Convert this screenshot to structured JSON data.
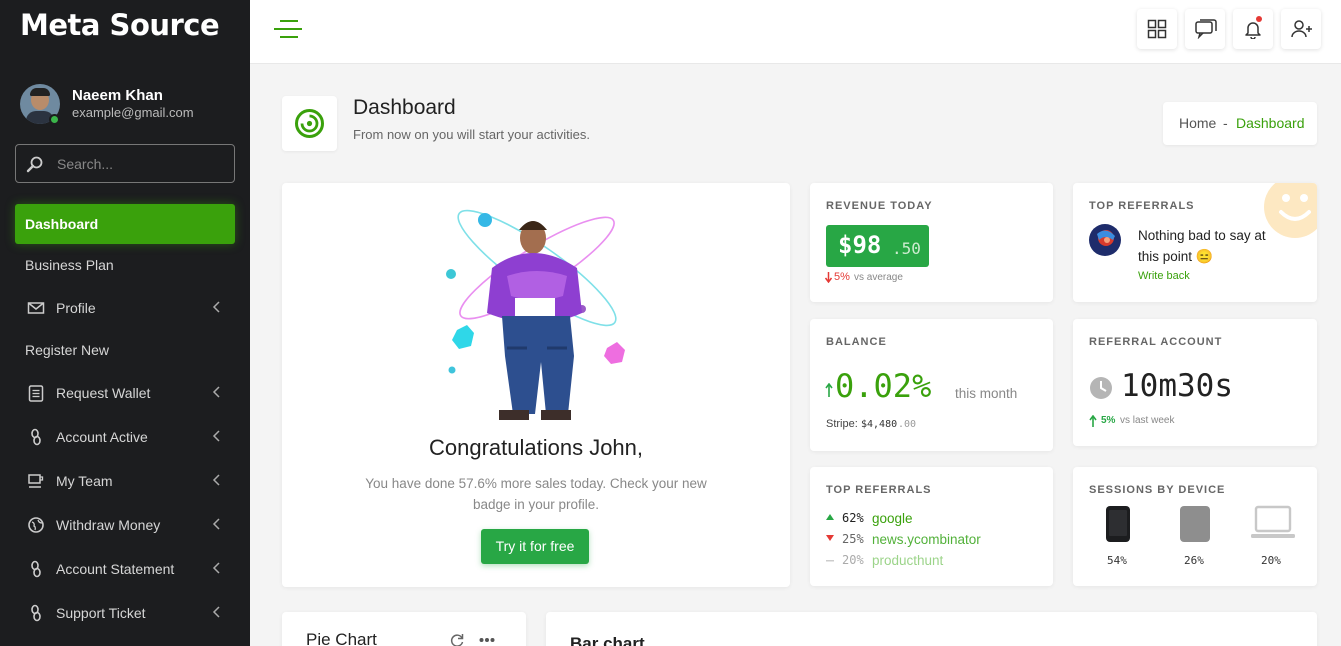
{
  "brand": "Meta Source",
  "user": {
    "name": "Naeem Khan",
    "email": "example@gmail.com"
  },
  "search": {
    "placeholder": "Search..."
  },
  "nav": [
    {
      "label": "Dashboard",
      "icon": "none",
      "active": true,
      "chevron": false
    },
    {
      "label": "Business Plan",
      "icon": "none",
      "chevron": false
    },
    {
      "label": "Profile",
      "icon": "envelope-icon",
      "chevron": true
    },
    {
      "label": "Register New",
      "icon": "none",
      "chevron": false
    },
    {
      "label": "Request Wallet",
      "icon": "clipboard-icon",
      "chevron": true
    },
    {
      "label": "Account Active",
      "icon": "link-icon",
      "chevron": true
    },
    {
      "label": "My Team",
      "icon": "cup-icon",
      "chevron": true
    },
    {
      "label": "Withdraw Money",
      "icon": "globe-icon",
      "chevron": true
    },
    {
      "label": "Account Statement",
      "icon": "link-icon",
      "chevron": true
    },
    {
      "label": "Support Ticket",
      "icon": "link-icon",
      "chevron": true
    }
  ],
  "topbar": {
    "icons": [
      "grid-icon",
      "chat-icon",
      "bell-icon",
      "add-user-icon"
    ]
  },
  "page": {
    "title": "Dashboard",
    "subtitle": "From now on you will start your activities.",
    "breadcrumb": {
      "home": "Home",
      "sep": "-",
      "current": "Dashboard"
    }
  },
  "congrats": {
    "title": "Congratulations John,",
    "text": "You have done 57.6% more sales today. Check your new badge in your profile.",
    "button": "Try it for free"
  },
  "revenue": {
    "label": "REVENUE TODAY",
    "amount": "$98",
    "cents": ".50",
    "change": "5%",
    "change_text": "vs average"
  },
  "top_referrals_1": {
    "label": "TOP REFERRALS",
    "message": "Nothing bad to say at this point",
    "emoji": "😑",
    "link": "Write back"
  },
  "balance": {
    "label": "BALANCE",
    "value": "0.02%",
    "period": "this month",
    "stripe_label": "Stripe:",
    "stripe_amount": "$4,480",
    "stripe_cents": ".00"
  },
  "referral_account": {
    "label": "REFERRAL ACCOUNT",
    "value": "10m30s",
    "change": "5%",
    "change_text": "vs last week"
  },
  "top_referrals_2": {
    "label": "TOP REFERRALS",
    "items": [
      {
        "pct": "62%",
        "name": "google",
        "trend": "up"
      },
      {
        "pct": "25%",
        "name": "news.ycombinator",
        "trend": "down"
      },
      {
        "pct": "20%",
        "name": "producthunt",
        "trend": "flat"
      }
    ]
  },
  "sessions": {
    "label": "SESSIONS BY DEVICE",
    "devices": [
      {
        "icon": "phone-icon",
        "pct": "54%"
      },
      {
        "icon": "tablet-icon",
        "pct": "26%"
      },
      {
        "icon": "laptop-icon",
        "pct": "20%"
      }
    ]
  },
  "pie_chart": {
    "title": "Pie Chart"
  },
  "bar_chart": {
    "title": "Bar chart"
  },
  "colors": {
    "accent": "#3aa10c",
    "sidebar": "#1c1d1f",
    "danger": "#e53935"
  }
}
